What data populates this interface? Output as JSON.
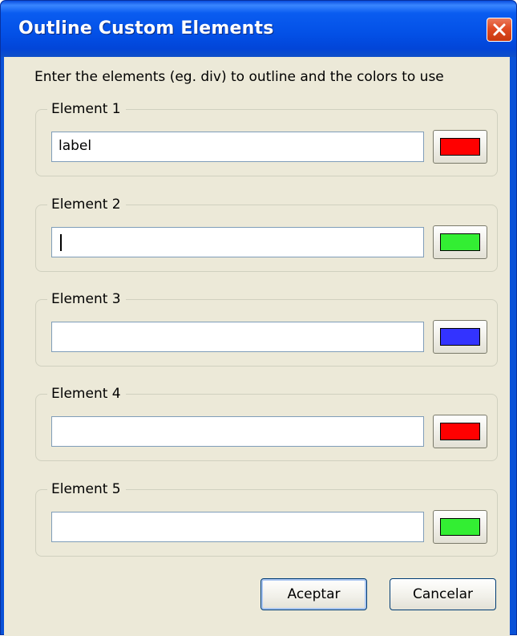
{
  "window": {
    "title": "Outline Custom Elements"
  },
  "dialog": {
    "prompt": "Enter the elements (eg. div) to outline and the colors to use",
    "elements": [
      {
        "label": "Element 1",
        "value": "label",
        "color": "#ff0000"
      },
      {
        "label": "Element 2",
        "value": "",
        "color": "#33ee33"
      },
      {
        "label": "Element 3",
        "value": "",
        "color": "#3333ff"
      },
      {
        "label": "Element 4",
        "value": "",
        "color": "#ff0000"
      },
      {
        "label": "Element 5",
        "value": "",
        "color": "#33ee33"
      }
    ],
    "ok_label": "Aceptar",
    "cancel_label": "Cancelar"
  },
  "icons": {
    "close": "close-icon"
  }
}
